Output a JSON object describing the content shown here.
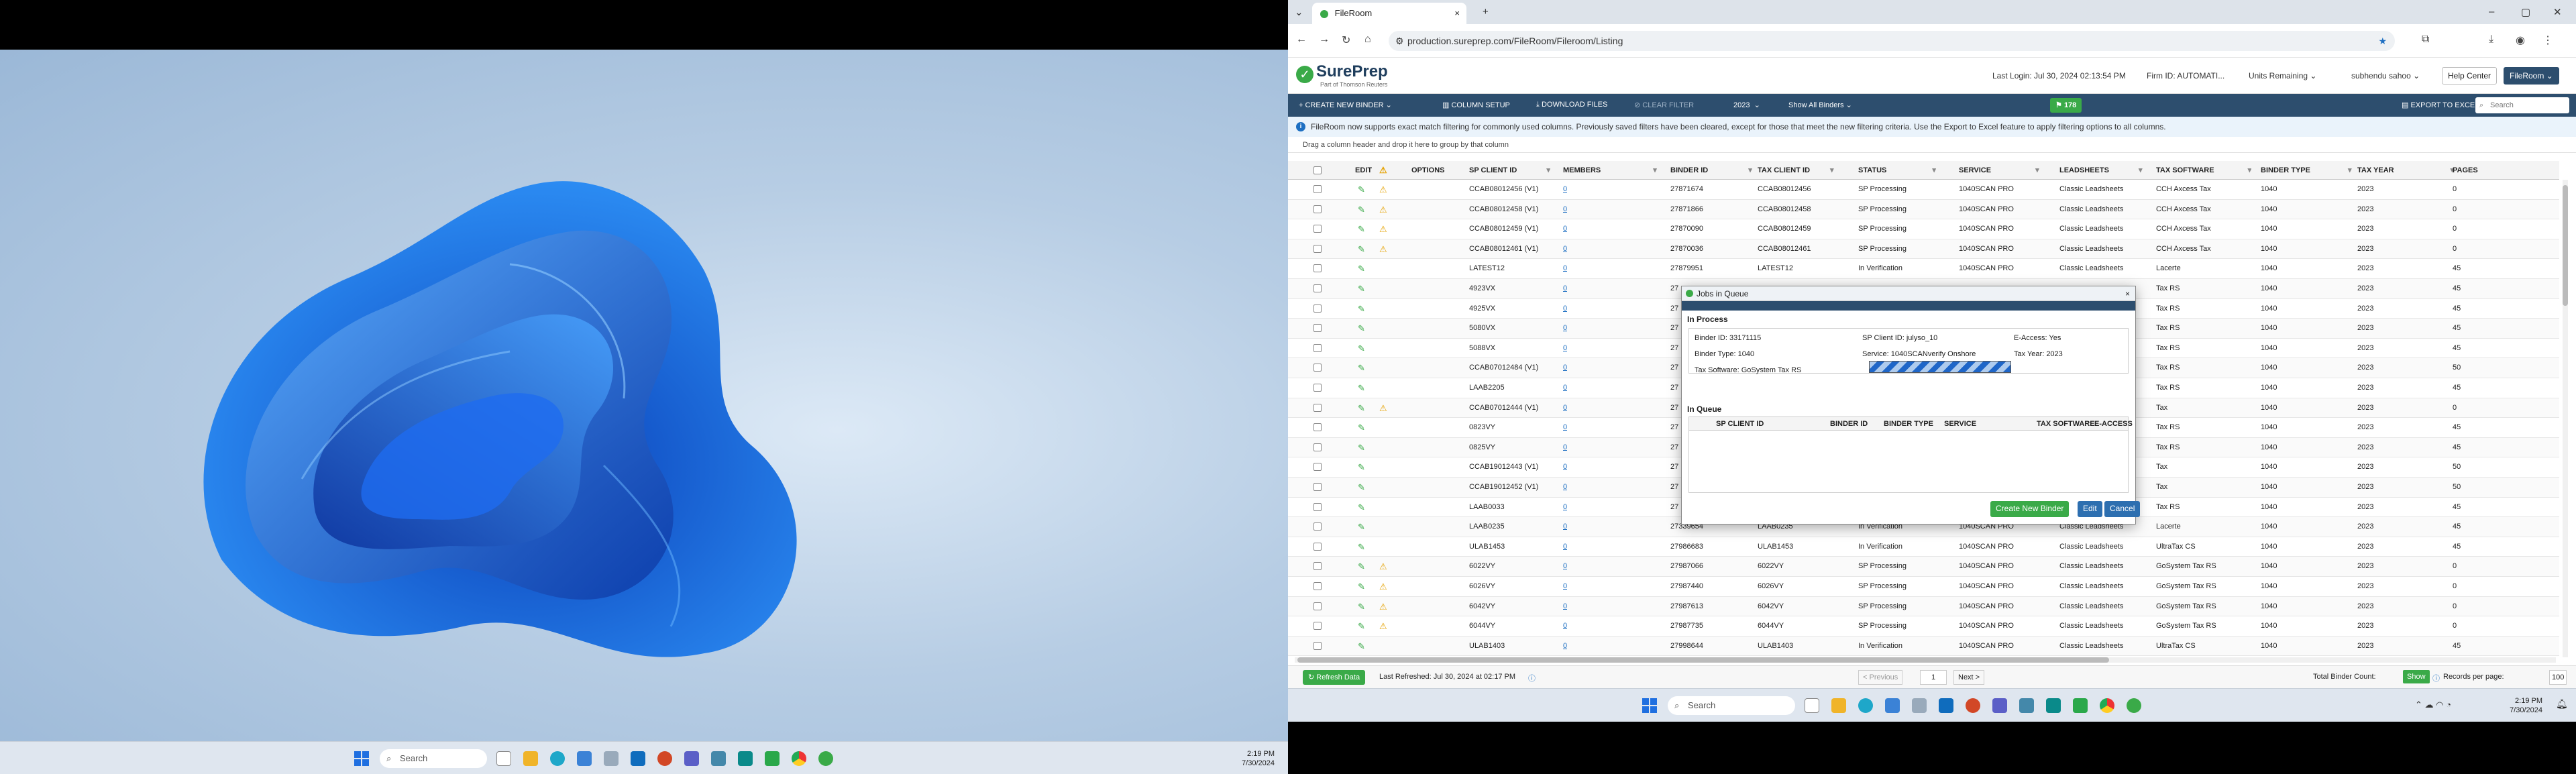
{
  "left_taskbar": {
    "search_placeholder": "Search",
    "time": "2:19 PM",
    "date": "7/30/2024"
  },
  "browser": {
    "tab_title": "FileRoom",
    "url": "production.sureprep.com/FileRoom/Fileroom/Listing"
  },
  "header": {
    "logo": "SurePrep",
    "logo_sub": "Part of Thomson Reuters",
    "last_login": "Last Login: Jul 30, 2024 02:13:54 PM",
    "firm_id": "Firm ID: AUTOMATI...",
    "units": "Units Remaining",
    "user": "subhendu sahoo",
    "help": "Help Center",
    "fileroom": "FileRoom"
  },
  "toolbar": {
    "create": "+ CREATE NEW BINDER",
    "column_setup": "COLUMN SETUP",
    "download": "DOWNLOAD FILES",
    "clear": "CLEAR FILTER",
    "year": "2023",
    "show": "Show All Binders",
    "count": "178",
    "export": "EXPORT TO EXCEL",
    "search_placeholder": "Search"
  },
  "notice": "FileRoom now supports exact match filtering for commonly used columns. Previously saved filters have been cleared, except for those that meet the new filtering criteria. Use the Export to Excel feature to apply filtering options to all columns.",
  "drag_hint": "Drag a column header and drop it here to group by that column",
  "columns": {
    "edit": "EDIT",
    "options": "OPTIONS",
    "sp_client_id": "SP CLIENT ID",
    "members": "MEMBERS",
    "binder_id": "BINDER ID",
    "tax_client_id": "TAX CLIENT ID",
    "status": "STATUS",
    "service": "SERVICE",
    "leadsheets": "LEADSHEETS",
    "tax_software": "TAX SOFTWARE",
    "binder_type": "BINDER TYPE",
    "tax_year": "TAX YEAR",
    "pages": "PAGES"
  },
  "rows": [
    {
      "w": true,
      "sp": "CCAB08012456 (V1)",
      "m": "0",
      "b": "27871674",
      "t": "CCAB08012456",
      "s": "SP Processing",
      "sv": "1040SCAN PRO",
      "l": "Classic Leadsheets",
      "ts": "CCH Axcess Tax",
      "bt": "1040",
      "y": "2023",
      "p": "0"
    },
    {
      "w": true,
      "sp": "CCAB08012458 (V1)",
      "m": "0",
      "b": "27871866",
      "t": "CCAB08012458",
      "s": "SP Processing",
      "sv": "1040SCAN PRO",
      "l": "Classic Leadsheets",
      "ts": "CCH Axcess Tax",
      "bt": "1040",
      "y": "2023",
      "p": "0"
    },
    {
      "w": true,
      "sp": "CCAB08012459 (V1)",
      "m": "0",
      "b": "27870090",
      "t": "CCAB08012459",
      "s": "SP Processing",
      "sv": "1040SCAN PRO",
      "l": "Classic Leadsheets",
      "ts": "CCH Axcess Tax",
      "bt": "1040",
      "y": "2023",
      "p": "0"
    },
    {
      "w": true,
      "sp": "CCAB08012461 (V1)",
      "m": "0",
      "b": "27870036",
      "t": "CCAB08012461",
      "s": "SP Processing",
      "sv": "1040SCAN PRO",
      "l": "Classic Leadsheets",
      "ts": "CCH Axcess Tax",
      "bt": "1040",
      "y": "2023",
      "p": "0"
    },
    {
      "w": false,
      "sp": "LATEST12",
      "m": "0",
      "b": "27879951",
      "t": "LATEST12",
      "s": "In Verification",
      "sv": "1040SCAN PRO",
      "l": "Classic Leadsheets",
      "ts": "Lacerte",
      "bt": "1040",
      "y": "2023",
      "p": "45"
    },
    {
      "w": false,
      "sp": "4923VX",
      "m": "0",
      "b": "27",
      "t": "",
      "s": "",
      "sv": "",
      "l": "",
      "ts": "Tax RS",
      "bt": "1040",
      "y": "2023",
      "p": "45"
    },
    {
      "w": false,
      "sp": "4925VX",
      "m": "0",
      "b": "27",
      "t": "",
      "s": "",
      "sv": "",
      "l": "",
      "ts": "Tax RS",
      "bt": "1040",
      "y": "2023",
      "p": "45"
    },
    {
      "w": false,
      "sp": "5080VX",
      "m": "0",
      "b": "27",
      "t": "",
      "s": "",
      "sv": "",
      "l": "",
      "ts": "Tax RS",
      "bt": "1040",
      "y": "2023",
      "p": "45"
    },
    {
      "w": false,
      "sp": "5088VX",
      "m": "0",
      "b": "27",
      "t": "",
      "s": "",
      "sv": "",
      "l": "",
      "ts": "Tax RS",
      "bt": "1040",
      "y": "2023",
      "p": "45"
    },
    {
      "w": false,
      "sp": "CCAB07012484 (V1)",
      "m": "0",
      "b": "27",
      "t": "",
      "s": "",
      "sv": "",
      "l": "",
      "ts": "Tax RS",
      "bt": "1040",
      "y": "2023",
      "p": "50"
    },
    {
      "w": false,
      "sp": "LAAB2205",
      "m": "0",
      "b": "27",
      "t": "",
      "s": "",
      "sv": "",
      "l": "",
      "ts": "Tax RS",
      "bt": "1040",
      "y": "2023",
      "p": "45"
    },
    {
      "w": true,
      "sp": "CCAB07012444 (V1)",
      "m": "0",
      "b": "27",
      "t": "",
      "s": "",
      "sv": "",
      "l": "",
      "ts": "Tax",
      "bt": "1040",
      "y": "2023",
      "p": "0"
    },
    {
      "w": false,
      "sp": "0823VY",
      "m": "0",
      "b": "27",
      "t": "",
      "s": "",
      "sv": "",
      "l": "",
      "ts": "Tax RS",
      "bt": "1040",
      "y": "2023",
      "p": "45"
    },
    {
      "w": false,
      "sp": "0825VY",
      "m": "0",
      "b": "27",
      "t": "",
      "s": "",
      "sv": "",
      "l": "",
      "ts": "Tax RS",
      "bt": "1040",
      "y": "2023",
      "p": "45"
    },
    {
      "w": false,
      "sp": "CCAB19012443 (V1)",
      "m": "0",
      "b": "27",
      "t": "",
      "s": "",
      "sv": "",
      "l": "",
      "ts": "Tax",
      "bt": "1040",
      "y": "2023",
      "p": "50"
    },
    {
      "w": false,
      "sp": "CCAB19012452 (V1)",
      "m": "0",
      "b": "27",
      "t": "",
      "s": "",
      "sv": "",
      "l": "",
      "ts": "Tax",
      "bt": "1040",
      "y": "2023",
      "p": "50"
    },
    {
      "w": false,
      "sp": "LAAB0033",
      "m": "0",
      "b": "27",
      "t": "",
      "s": "",
      "sv": "",
      "l": "",
      "ts": "Tax RS",
      "bt": "1040",
      "y": "2023",
      "p": "45"
    },
    {
      "w": false,
      "sp": "LAAB0235",
      "m": "0",
      "b": "27339654",
      "t": "LAAB0235",
      "s": "In Verification",
      "sv": "1040SCAN PRO",
      "l": "Classic Leadsheets",
      "ts": "Lacerte",
      "bt": "1040",
      "y": "2023",
      "p": "45"
    },
    {
      "w": false,
      "sp": "ULAB1453",
      "m": "0",
      "b": "27986683",
      "t": "ULAB1453",
      "s": "In Verification",
      "sv": "1040SCAN PRO",
      "l": "Classic Leadsheets",
      "ts": "UltraTax CS",
      "bt": "1040",
      "y": "2023",
      "p": "45"
    },
    {
      "w": true,
      "sp": "6022VY",
      "m": "0",
      "b": "27987066",
      "t": "6022VY",
      "s": "SP Processing",
      "sv": "1040SCAN PRO",
      "l": "Classic Leadsheets",
      "ts": "GoSystem Tax RS",
      "bt": "1040",
      "y": "2023",
      "p": "0"
    },
    {
      "w": true,
      "sp": "6026VY",
      "m": "0",
      "b": "27987440",
      "t": "6026VY",
      "s": "SP Processing",
      "sv": "1040SCAN PRO",
      "l": "Classic Leadsheets",
      "ts": "GoSystem Tax RS",
      "bt": "1040",
      "y": "2023",
      "p": "0"
    },
    {
      "w": true,
      "sp": "6042VY",
      "m": "0",
      "b": "27987613",
      "t": "6042VY",
      "s": "SP Processing",
      "sv": "1040SCAN PRO",
      "l": "Classic Leadsheets",
      "ts": "GoSystem Tax RS",
      "bt": "1040",
      "y": "2023",
      "p": "0"
    },
    {
      "w": true,
      "sp": "6044VY",
      "m": "0",
      "b": "27987735",
      "t": "6044VY",
      "s": "SP Processing",
      "sv": "1040SCAN PRO",
      "l": "Classic Leadsheets",
      "ts": "GoSystem Tax RS",
      "bt": "1040",
      "y": "2023",
      "p": "0"
    },
    {
      "w": false,
      "sp": "ULAB1403",
      "m": "0",
      "b": "27998644",
      "t": "ULAB1403",
      "s": "In Verification",
      "sv": "1040SCAN PRO",
      "l": "Classic Leadsheets",
      "ts": "UltraTax CS",
      "bt": "1040",
      "y": "2023",
      "p": "45"
    }
  ],
  "footer": {
    "refresh": "Refresh Data",
    "last_refreshed": "Last Refreshed: Jul 30, 2024 at 02:17 PM",
    "previous": "< Previous",
    "page": "1",
    "next": "Next >",
    "total": "Total Binder Count:",
    "show": "Show",
    "per_page": "Records per page:",
    "per_page_value": "100"
  },
  "modal": {
    "title": "Jobs in Queue",
    "in_process": "In Process",
    "binder_id": "Binder ID: 33171115",
    "sp_client_id": "SP Client ID: julyso_10",
    "eaccess": "E-Access: Yes",
    "binder_type": "Binder Type: 1040",
    "service": "Service: 1040SCANverify Onshore",
    "tax_year": "Tax Year: 2023",
    "tax_software": "Tax Software: GoSystem Tax RS",
    "in_queue": "In Queue",
    "q_cols": [
      "SP CLIENT ID",
      "BINDER ID",
      "BINDER TYPE",
      "SERVICE",
      "TAX SOFTWARE",
      "E-ACCESS"
    ],
    "create": "Create New Binder",
    "edit": "Edit",
    "cancel": "Cancel"
  },
  "right_taskbar": {
    "search_placeholder": "Search",
    "time": "2:19 PM",
    "date": "7/30/2024"
  },
  "colors": {
    "navy": "#2d4e6e",
    "green": "#3aaa48",
    "warning": "#e5a200",
    "link": "#1d6fc2"
  }
}
